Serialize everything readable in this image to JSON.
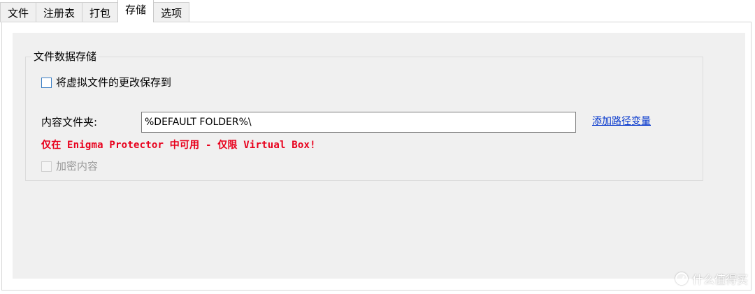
{
  "tabs": [
    {
      "label": "文件",
      "active": false
    },
    {
      "label": "注册表",
      "active": false
    },
    {
      "label": "打包",
      "active": false
    },
    {
      "label": "存储",
      "active": true
    },
    {
      "label": "选项",
      "active": false
    }
  ],
  "storage": {
    "group_title": "文件数据存储",
    "save_changes_label": "将虚拟文件的更改保存到",
    "save_changes_checked": false,
    "content_folder_label": "内容文件夹:",
    "content_folder_value": "%DEFAULT FOLDER%\\",
    "add_path_variable_label": "添加路径变量",
    "warning_text": "仅在 Enigma Protector 中可用 - 仅限 Virtual Box!",
    "encrypt_content_label": "加密内容",
    "encrypt_content_checked": false,
    "encrypt_content_enabled": false
  },
  "watermark": {
    "text": "什么值得买"
  },
  "colors": {
    "accent_link": "#0033cc",
    "warning": "#e8001c",
    "panel_bg": "#f0f0f0"
  }
}
